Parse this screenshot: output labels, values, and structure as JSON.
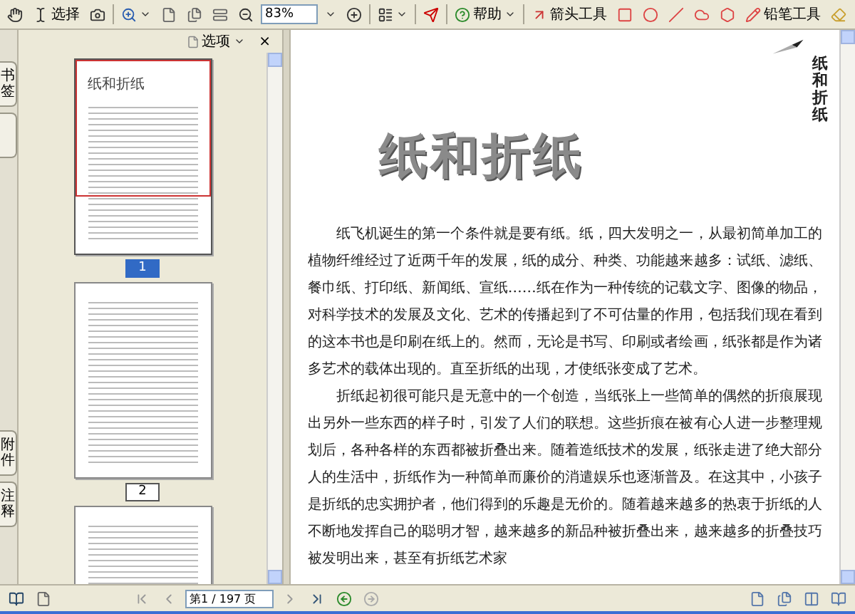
{
  "toolbar": {
    "select_label": "选择",
    "zoom_value": "83%",
    "help_label": "帮助",
    "arrow_tool_label": "箭头工具",
    "pencil_tool_label": "铅笔工具"
  },
  "side_tabs": {
    "top": [
      {
        "label": "书签"
      }
    ],
    "bottom": [
      {
        "label": "附件"
      },
      {
        "label": "注释"
      }
    ]
  },
  "thumbnails_panel": {
    "options_label": "选项",
    "close": "×",
    "pages": [
      {
        "title": "纸和折纸",
        "label": "1",
        "selected": true
      },
      {
        "label": "2",
        "selected": false
      },
      {
        "selected": false
      }
    ]
  },
  "document": {
    "side_title": "纸和折纸",
    "title": "纸和折纸",
    "paragraphs": [
      "纸飞机诞生的第一个条件就是要有纸。纸，四大发明之一，从最初简单加工的植物纤维经过了近两千年的发展，纸的成分、种类、功能越来越多：试纸、滤纸、餐巾纸、打印纸、新闻纸、宣纸……纸在作为一种传统的记载文字、图像的物品，对科学技术的发展及文化、艺术的传播起到了不可估量的作用，包括我们现在看到的这本书也是印刷在纸上的。然而，无论是书写、印刷或者绘画，纸张都是作为诸多艺术的载体出现的。直至折纸的出现，才使纸张变成了艺术。",
      "折纸起初很可能只是无意中的一个创造，当纸张上一些简单的偶然的折痕展现出另外一些东西的样子时，引发了人们的联想。这些折痕在被有心人进一步整理规划后，各种各样的东西都被折叠出来。随着造纸技术的发展，纸张走进了绝大部分人的生活中，折纸作为一种简单而廉价的消遣娱乐也逐渐普及。在这其中，小孩子是折纸的忠实拥护者，他们得到的乐趣是无价的。随着越来越多的热衷于折纸的人不断地发挥自己的聪明才智，越来越多的新品种被折叠出来，越来越多的折叠技巧被发明出来，甚至有折纸艺术家"
    ]
  },
  "navigation": {
    "page_field": "第1 / 197 页"
  }
}
